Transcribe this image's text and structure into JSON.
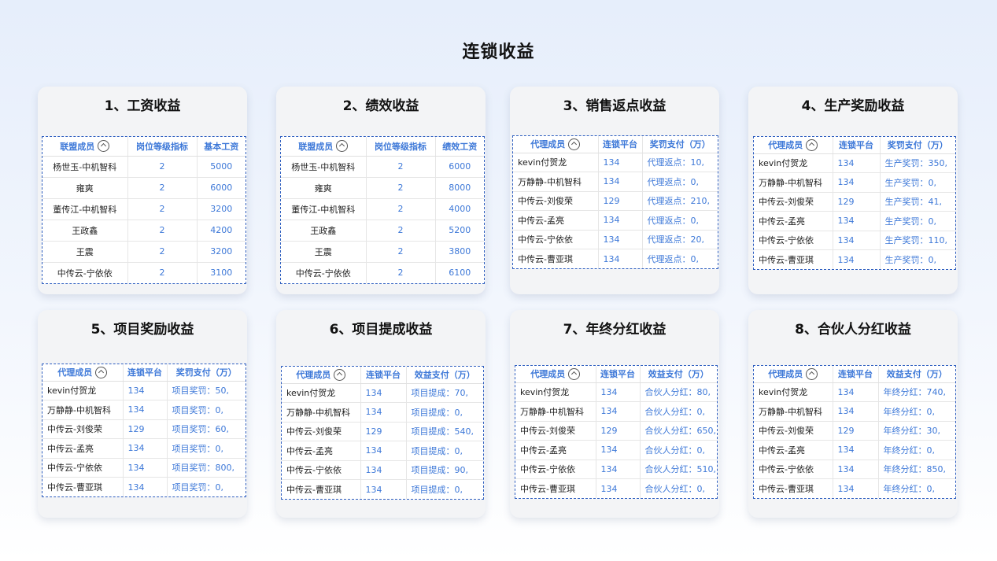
{
  "page_title": "连锁收益",
  "cards": [
    {
      "title": "1、工资收益",
      "headers": [
        "联盟成员",
        "岗位等级指标",
        "基本工资"
      ],
      "rows": [
        [
          "杨世玉-中机智科",
          "2",
          "5000"
        ],
        [
          "雍爽",
          "2",
          "6000"
        ],
        [
          "董传江-中机智科",
          "2",
          "3200"
        ],
        [
          "王政鑫",
          "2",
          "4200"
        ],
        [
          "王震",
          "2",
          "3200"
        ],
        [
          "中传云-宁依依",
          "2",
          "3100"
        ]
      ]
    },
    {
      "title": "2、绩效收益",
      "headers": [
        "联盟成员",
        "岗位等级指标",
        "绩效工资"
      ],
      "rows": [
        [
          "杨世玉-中机智科",
          "2",
          "6000"
        ],
        [
          "雍爽",
          "2",
          "8000"
        ],
        [
          "董传江-中机智科",
          "2",
          "4000"
        ],
        [
          "王政鑫",
          "2",
          "5200"
        ],
        [
          "王震",
          "2",
          "3800"
        ],
        [
          "中传云-宁依依",
          "2",
          "6100"
        ]
      ]
    },
    {
      "title": "3、销售返点收益",
      "headers": [
        "代理成员",
        "连锁平台",
        "奖罚支付（万）"
      ],
      "rows": [
        [
          "kevin付贺龙",
          "134",
          "代理返点：10,"
        ],
        [
          "万静静-中机智科",
          "134",
          "代理返点：0,"
        ],
        [
          "中传云-刘俊荣",
          "129",
          "代理返点：210,"
        ],
        [
          "中传云-孟亮",
          "134",
          "代理返点：0,"
        ],
        [
          "中传云-宁依依",
          "134",
          "代理返点：20,"
        ],
        [
          "中传云-曹亚琪",
          "134",
          "代理返点：0,"
        ]
      ]
    },
    {
      "title": "4、生产奖励收益",
      "headers": [
        "代理成员",
        "连锁平台",
        "奖罚支付（万）"
      ],
      "rows": [
        [
          "kevin付贺龙",
          "134",
          "生产奖罚：350,"
        ],
        [
          "万静静-中机智科",
          "134",
          "生产奖罚：0,"
        ],
        [
          "中传云-刘俊荣",
          "129",
          "生产奖罚：41,"
        ],
        [
          "中传云-孟亮",
          "134",
          "生产奖罚：0,"
        ],
        [
          "中传云-宁依依",
          "134",
          "生产奖罚：110,"
        ],
        [
          "中传云-曹亚琪",
          "134",
          "生产奖罚：0,"
        ]
      ]
    },
    {
      "title": "5、项目奖励收益",
      "headers": [
        "代理成员",
        "连锁平台",
        "奖罚支付（万）"
      ],
      "rows": [
        [
          "kevin付贺龙",
          "134",
          "项目奖罚：50,"
        ],
        [
          "万静静-中机智科",
          "134",
          "项目奖罚：0,"
        ],
        [
          "中传云-刘俊荣",
          "129",
          "项目奖罚：60,"
        ],
        [
          "中传云-孟亮",
          "134",
          "项目奖罚：0,"
        ],
        [
          "中传云-宁依依",
          "134",
          "项目奖罚：800,"
        ],
        [
          "中传云-曹亚琪",
          "134",
          "项目奖罚：0,"
        ]
      ]
    },
    {
      "title": "6、项目提成收益",
      "headers": [
        "代理成员",
        "连锁平台",
        "效益支付（万）"
      ],
      "rows": [
        [
          "kevin付贺龙",
          "134",
          "项目提成：70,"
        ],
        [
          "万静静-中机智科",
          "134",
          "项目提成：0,"
        ],
        [
          "中传云-刘俊荣",
          "129",
          "项目提成：540,"
        ],
        [
          "中传云-孟亮",
          "134",
          "项目提成：0,"
        ],
        [
          "中传云-宁依依",
          "134",
          "项目提成：90,"
        ],
        [
          "中传云-曹亚琪",
          "134",
          "项目提成：0,"
        ]
      ]
    },
    {
      "title": "7、年终分红收益",
      "headers": [
        "代理成员",
        "连锁平台",
        "效益支付（万）"
      ],
      "rows": [
        [
          "kevin付贺龙",
          "134",
          "合伙人分红：80,"
        ],
        [
          "万静静-中机智科",
          "134",
          "合伙人分红：0,"
        ],
        [
          "中传云-刘俊荣",
          "129",
          "合伙人分红：650,"
        ],
        [
          "中传云-孟亮",
          "134",
          "合伙人分红：0,"
        ],
        [
          "中传云-宁依依",
          "134",
          "合伙人分红：510,"
        ],
        [
          "中传云-曹亚琪",
          "134",
          "合伙人分红：0,"
        ]
      ]
    },
    {
      "title": "8、合伙人分红收益",
      "headers": [
        "代理成员",
        "连锁平台",
        "效益支付（万）"
      ],
      "rows": [
        [
          "kevin付贺龙",
          "134",
          "年终分红：740,"
        ],
        [
          "万静静-中机智科",
          "134",
          "年终分红：0,"
        ],
        [
          "中传云-刘俊荣",
          "129",
          "年终分红：30,"
        ],
        [
          "中传云-孟亮",
          "134",
          "年终分红：0,"
        ],
        [
          "中传云-宁依依",
          "134",
          "年终分红：850,"
        ],
        [
          "中传云-曹亚琪",
          "134",
          "年终分红：0,"
        ]
      ]
    }
  ]
}
